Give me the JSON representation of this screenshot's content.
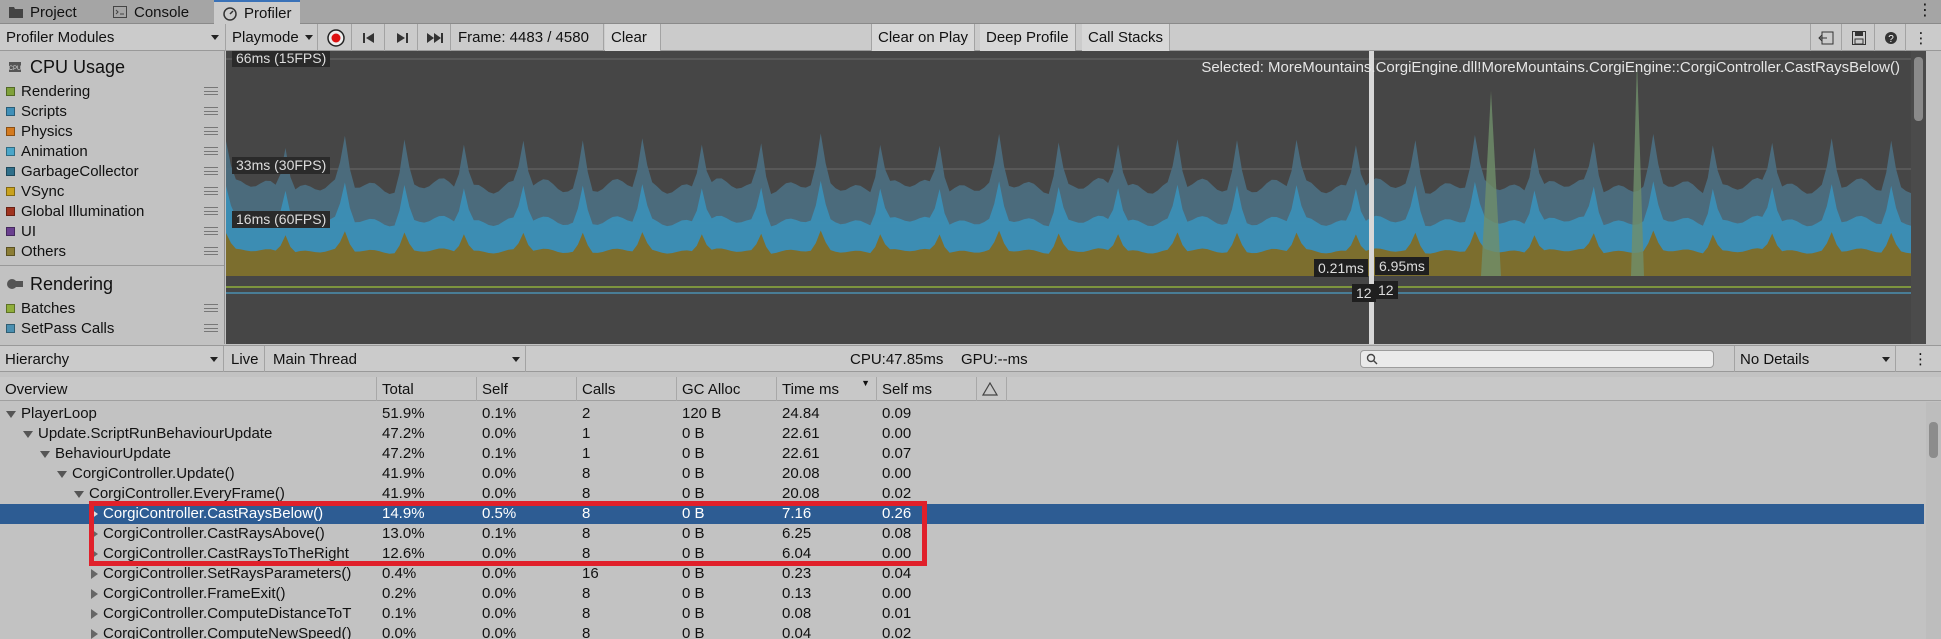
{
  "tabs": [
    {
      "label": "Project",
      "icon": "folder-icon"
    },
    {
      "label": "Console",
      "icon": "console-icon"
    },
    {
      "label": "Profiler",
      "icon": "profiler-icon",
      "active": true
    }
  ],
  "toolbar": {
    "modules_label": "Profiler Modules",
    "target_label": "Playmode",
    "frame_label": "Frame: 4483 / 4580",
    "clear_label": "Clear",
    "clear_on_play_label": "Clear on Play",
    "deep_profile_label": "Deep Profile",
    "call_stacks_label": "Call Stacks"
  },
  "modules": {
    "cpu_title": "CPU Usage",
    "cpu_items": [
      {
        "label": "Rendering",
        "color": "#7fa13a"
      },
      {
        "label": "Scripts",
        "color": "#3f8fb8"
      },
      {
        "label": "Physics",
        "color": "#d47a1f"
      },
      {
        "label": "Animation",
        "color": "#4aa6c9"
      },
      {
        "label": "GarbageCollector",
        "color": "#2f6f8a"
      },
      {
        "label": "VSync",
        "color": "#c9a21d"
      },
      {
        "label": "Global Illumination",
        "color": "#a0331f"
      },
      {
        "label": "UI",
        "color": "#6a3f8f"
      },
      {
        "label": "Others",
        "color": "#8b7d35"
      }
    ],
    "rendering_title": "Rendering",
    "rendering_items": [
      {
        "label": "Batches",
        "color": "#8fae3b"
      },
      {
        "label": "SetPass Calls",
        "color": "#4a8fb0"
      }
    ]
  },
  "chart": {
    "fps_66": "66ms (15FPS)",
    "fps_33": "33ms (30FPS)",
    "fps_16": "16ms (60FPS)",
    "selected_text": "Selected: MoreMountains.CorgiEngine.dll!MoreMountains.CorgiEngine::CorgiController.CastRaysBelow()",
    "cursor_left": "0.21ms",
    "cursor_right": "6.95ms",
    "render_left": "12",
    "render_right": "12"
  },
  "hierarchy_bar": {
    "view_label": "Hierarchy",
    "live_label": "Live",
    "thread_label": "Main Thread",
    "cpu_label": "CPU:47.85ms",
    "gpu_label": "GPU:--ms",
    "search_value": "",
    "details_label": "No Details"
  },
  "columns": [
    "Overview",
    "Total",
    "Self",
    "Calls",
    "GC Alloc",
    "Time ms",
    "Self ms"
  ],
  "rows": [
    {
      "name": "PlayerLoop",
      "total": "51.9%",
      "self": "0.1%",
      "calls": "2",
      "gc": "120 B",
      "time": "24.84",
      "selfms": "0.09"
    },
    {
      "name": "Update.ScriptRunBehaviourUpdate",
      "total": "47.2%",
      "self": "0.0%",
      "calls": "1",
      "gc": "0 B",
      "time": "22.61",
      "selfms": "0.00"
    },
    {
      "name": "BehaviourUpdate",
      "total": "47.2%",
      "self": "0.1%",
      "calls": "1",
      "gc": "0 B",
      "time": "22.61",
      "selfms": "0.07"
    },
    {
      "name": "CorgiController.Update()",
      "total": "41.9%",
      "self": "0.0%",
      "calls": "8",
      "gc": "0 B",
      "time": "20.08",
      "selfms": "0.00"
    },
    {
      "name": "CorgiController.EveryFrame()",
      "total": "41.9%",
      "self": "0.0%",
      "calls": "8",
      "gc": "0 B",
      "time": "20.08",
      "selfms": "0.02"
    },
    {
      "name": "CorgiController.CastRaysBelow()",
      "total": "14.9%",
      "self": "0.5%",
      "calls": "8",
      "gc": "0 B",
      "time": "7.16",
      "selfms": "0.26"
    },
    {
      "name": "CorgiController.CastRaysAbove()",
      "total": "13.0%",
      "self": "0.1%",
      "calls": "8",
      "gc": "0 B",
      "time": "6.25",
      "selfms": "0.08"
    },
    {
      "name": "CorgiController.CastRaysToTheRight",
      "total": "12.6%",
      "self": "0.0%",
      "calls": "8",
      "gc": "0 B",
      "time": "6.04",
      "selfms": "0.00"
    },
    {
      "name": "CorgiController.SetRaysParameters()",
      "total": "0.4%",
      "self": "0.0%",
      "calls": "16",
      "gc": "0 B",
      "time": "0.23",
      "selfms": "0.04"
    },
    {
      "name": "CorgiController.FrameExit()",
      "total": "0.2%",
      "self": "0.0%",
      "calls": "8",
      "gc": "0 B",
      "time": "0.13",
      "selfms": "0.00"
    },
    {
      "name": "CorgiController.ComputeDistanceToT",
      "total": "0.1%",
      "self": "0.0%",
      "calls": "8",
      "gc": "0 B",
      "time": "0.08",
      "selfms": "0.01"
    },
    {
      "name": "CorgiController.ComputeNewSpeed()",
      "total": "0.0%",
      "self": "0.0%",
      "calls": "8",
      "gc": "0 B",
      "time": "0.04",
      "selfms": "0.02"
    }
  ]
}
